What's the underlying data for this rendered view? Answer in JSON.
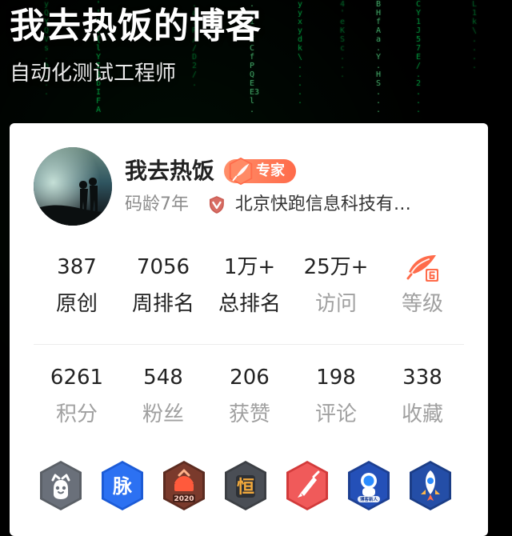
{
  "header": {
    "title": "我去热饭的博客",
    "subtitle": "自动化测试工程师"
  },
  "profile": {
    "name": "我去热饭",
    "expert_badge": "专家",
    "coding_age": "码龄7年",
    "company": "北京快跑信息科技有…"
  },
  "stats": {
    "top": [
      {
        "value": "387",
        "label": "原创"
      },
      {
        "value": "7056",
        "label": "周排名"
      },
      {
        "value": "1万+",
        "label": "总排名"
      },
      {
        "value": "25万+",
        "label": "访问"
      },
      {
        "value": "",
        "label": "等级",
        "icon": "level-6-icon"
      }
    ],
    "bottom": [
      {
        "value": "6261",
        "label": "积分"
      },
      {
        "value": "548",
        "label": "粉丝"
      },
      {
        "value": "206",
        "label": "获赞"
      },
      {
        "value": "198",
        "label": "评论"
      },
      {
        "value": "338",
        "label": "收藏"
      }
    ]
  },
  "badges": {
    "items": [
      {
        "icon": "github-icon"
      },
      {
        "icon": "mai-icon",
        "text": "脉"
      },
      {
        "icon": "anniversary-2020-icon",
        "text": "2020"
      },
      {
        "icon": "heng-icon",
        "text": "恒"
      },
      {
        "icon": "pen-icon"
      },
      {
        "icon": "astronaut-icon",
        "text": "博客新人"
      },
      {
        "icon": "rocket-icon"
      }
    ]
  },
  "colors": {
    "expert_gradient_start": "#ff8f6a",
    "expert_gradient_end": "#ff6b4a",
    "stat_label_dim": "#a0a0a0",
    "matrix_green": "#00ff66"
  }
}
